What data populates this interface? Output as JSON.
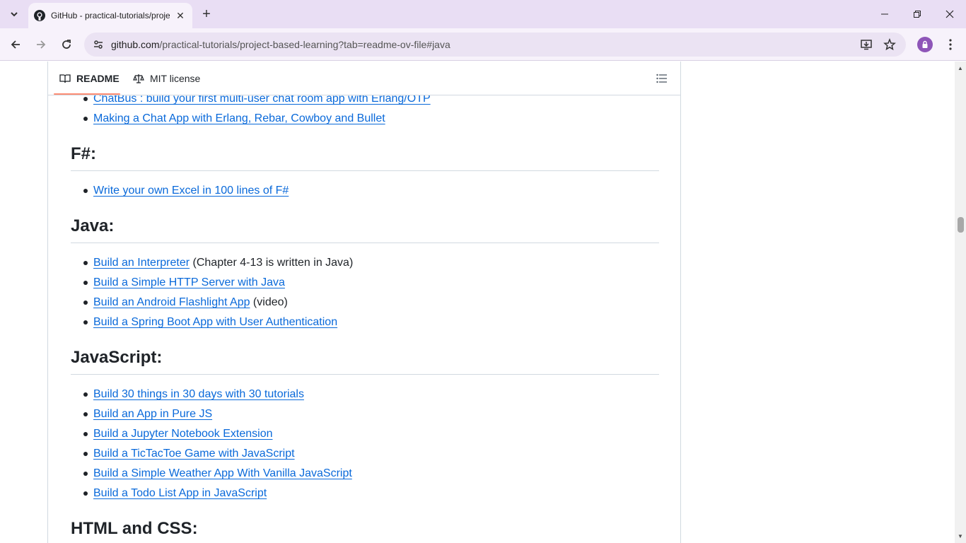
{
  "browser": {
    "tab_title": "GitHub - practical-tutorials/project-based-learning",
    "url_host": "github.com",
    "url_path": "/practical-tutorials/project-based-learning?tab=readme-ov-file#java"
  },
  "readme_tabs": {
    "readme": "README",
    "license": "MIT license"
  },
  "content": {
    "erlang_items": [
      "ChatBus : build your first multi-user chat room app with Erlang/OTP",
      "Making a Chat App with Erlang, Rebar, Cowboy and Bullet"
    ],
    "fsharp_heading": "F#:",
    "fsharp_items": [
      "Write your own Excel in 100 lines of F#"
    ],
    "java_heading": "Java:",
    "java_items": [
      {
        "link": "Build an Interpreter",
        "suffix": " (Chapter 4-13 is written in Java)"
      },
      {
        "link": "Build a Simple HTTP Server with Java",
        "suffix": ""
      },
      {
        "link": "Build an Android Flashlight App",
        "suffix": " (video)"
      },
      {
        "link": "Build a Spring Boot App with User Authentication",
        "suffix": ""
      }
    ],
    "js_heading": "JavaScript:",
    "js_items": [
      "Build 30 things in 30 days with 30 tutorials",
      "Build an App in Pure JS",
      "Build a Jupyter Notebook Extension",
      "Build a TicTacToe Game with JavaScript",
      "Build a Simple Weather App With Vanilla JavaScript",
      "Build a Todo List App in JavaScript"
    ],
    "htmlcss_heading": "HTML and CSS:"
  },
  "colors": {
    "link": "#0969da",
    "tab_underline": "#fd8c73",
    "chrome_bg": "#e9def4"
  }
}
